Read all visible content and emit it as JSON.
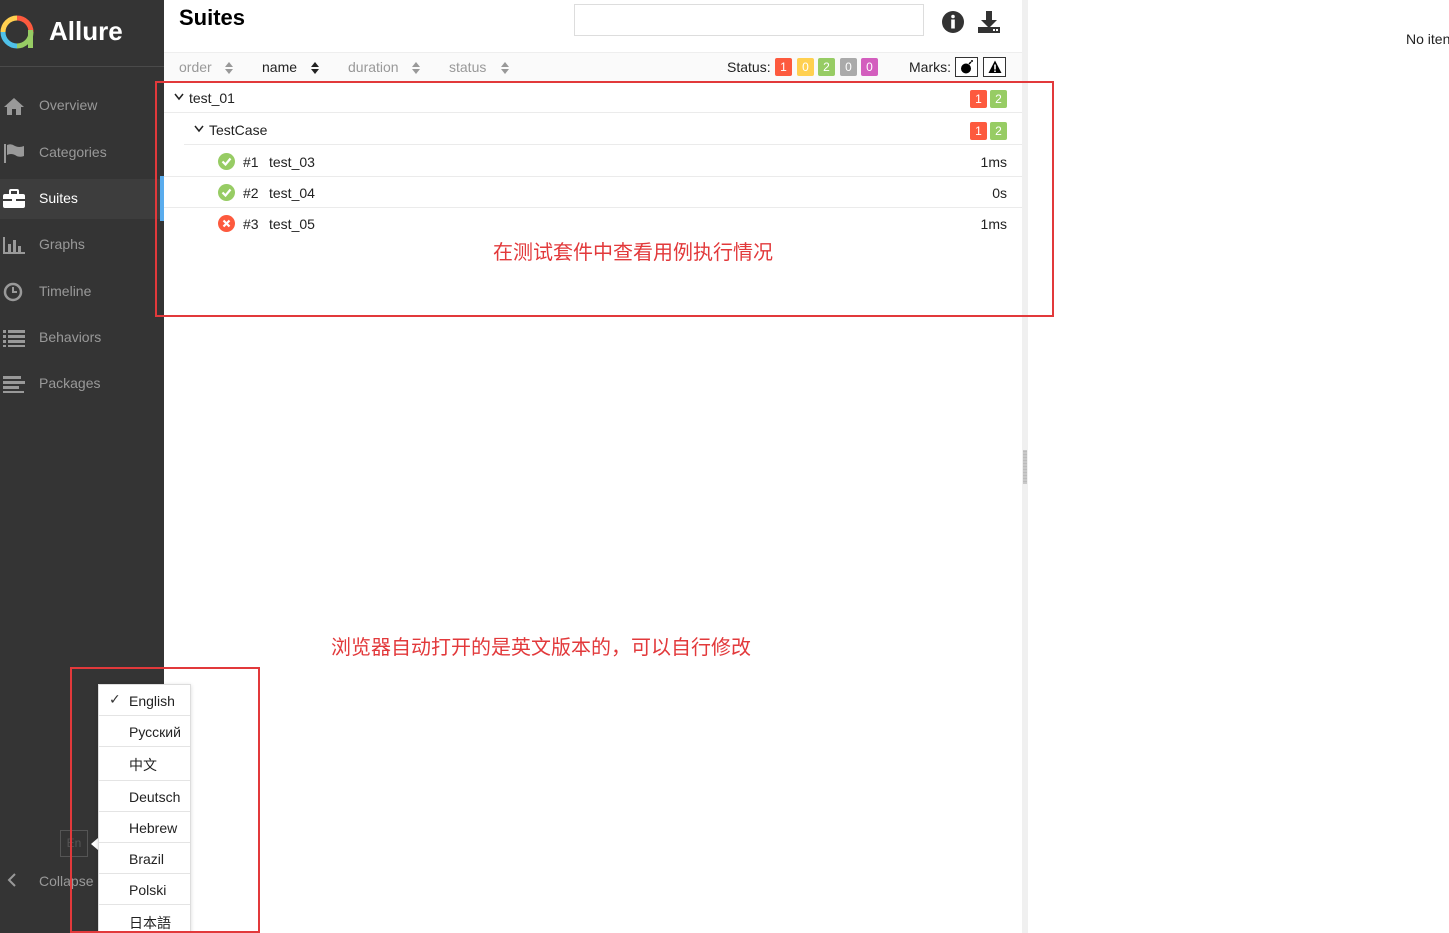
{
  "app": {
    "name": "Allure"
  },
  "sidebar": {
    "items": [
      {
        "label": "Overview",
        "icon": "home-icon",
        "active": false
      },
      {
        "label": "Categories",
        "icon": "flag-icon",
        "active": false
      },
      {
        "label": "Suites",
        "icon": "briefcase-icon",
        "active": true
      },
      {
        "label": "Graphs",
        "icon": "bar-chart-icon",
        "active": false
      },
      {
        "label": "Timeline",
        "icon": "clock-icon",
        "active": false
      },
      {
        "label": "Behaviors",
        "icon": "list-icon",
        "active": false
      },
      {
        "label": "Packages",
        "icon": "align-left-icon",
        "active": false
      }
    ],
    "language_button": "En",
    "collapse_label": "Collapse"
  },
  "languages": {
    "selected": "English",
    "items": [
      "English",
      "Русский",
      "中文",
      "Deutsch",
      "Hebrew",
      "Brazil",
      "Polski",
      "日本語"
    ]
  },
  "pane": {
    "title": "Suites",
    "search": {
      "value": "",
      "placeholder": ""
    },
    "sort": {
      "columns": [
        "order",
        "name",
        "duration",
        "status"
      ],
      "current": "name"
    },
    "status_filter": {
      "label": "Status:",
      "counts": [
        {
          "value": "1",
          "color": "#fd5a3e"
        },
        {
          "value": "0",
          "color": "#ffd050"
        },
        {
          "value": "2",
          "color": "#97cc64"
        },
        {
          "value": "0",
          "color": "#aaaaaa"
        },
        {
          "value": "0",
          "color": "#d35ebe"
        }
      ]
    },
    "marks": {
      "label": "Marks:",
      "icons": [
        "bomb-icon",
        "warning-icon"
      ]
    }
  },
  "tree": {
    "suite": {
      "name": "test_01",
      "failed": "1",
      "passed": "2"
    },
    "group": {
      "name": "TestCase",
      "failed": "1",
      "passed": "2"
    },
    "cases": [
      {
        "num": "#1",
        "name": "test_03",
        "duration": "1ms",
        "status": "passed"
      },
      {
        "num": "#2",
        "name": "test_04",
        "duration": "0s",
        "status": "passed"
      },
      {
        "num": "#3",
        "name": "test_05",
        "duration": "1ms",
        "status": "failed"
      }
    ]
  },
  "right_panel": {
    "text": "No iten"
  },
  "annotations": {
    "suites_note": "在测试套件中查看用例执行情况",
    "language_note": "浏览器自动打开的是英文版本的，可以自行修改"
  },
  "colors": {
    "failed": "#fd5a3e",
    "passed": "#97cc64",
    "annotation": "#e2393b",
    "sidebar": "#343434",
    "accent": "#5aaced"
  }
}
